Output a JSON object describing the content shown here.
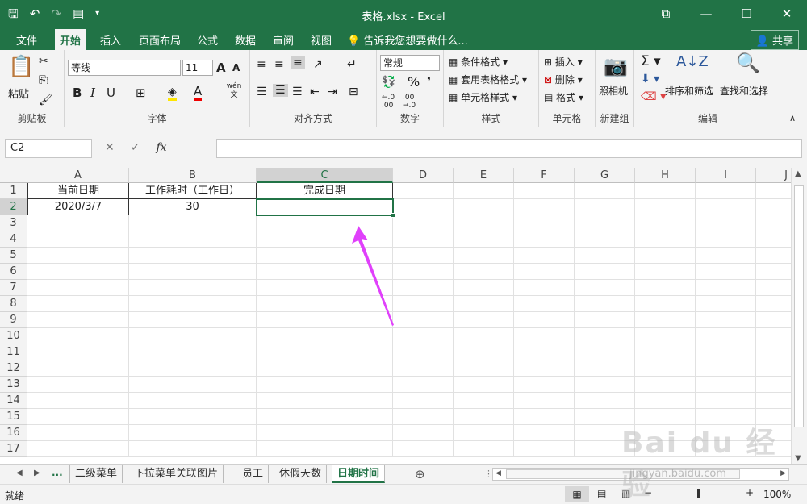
{
  "window": {
    "title": "表格.xlsx - Excel"
  },
  "menu": {
    "tabs": [
      "文件",
      "开始",
      "插入",
      "页面布局",
      "公式",
      "数据",
      "审阅",
      "视图"
    ],
    "tellme": "告诉我您想要做什么...",
    "share": "共享"
  },
  "ribbon": {
    "clipboard": {
      "paste": "粘贴",
      "label": "剪贴板"
    },
    "font": {
      "name": "等线",
      "size": "11",
      "grow": "A",
      "shrink": "A",
      "bold": "B",
      "italic": "I",
      "underline": "U",
      "color_a": "A",
      "phonetic": "wén 文",
      "label": "字体"
    },
    "align": {
      "label": "对齐方式"
    },
    "number": {
      "format": "常规",
      "percent": "%",
      "label": "数字"
    },
    "styles": {
      "conditional": "条件格式",
      "table": "套用表格格式",
      "cell": "单元格样式",
      "label": "样式"
    },
    "cells": {
      "insert": "插入",
      "delete": "删除",
      "format": "格式",
      "label": "单元格"
    },
    "newgroup": {
      "camera": "照相机",
      "label": "新建组"
    },
    "edit": {
      "sort": "排序和筛选",
      "find": "查找和选择",
      "label": "编辑"
    }
  },
  "formula": {
    "namebox": "C2",
    "fx": "fx",
    "value": ""
  },
  "columns": [
    "A",
    "B",
    "C",
    "D",
    "E",
    "F",
    "G",
    "H",
    "I",
    "J"
  ],
  "rows": [
    "1",
    "2",
    "3",
    "4",
    "5",
    "6",
    "7",
    "8",
    "9",
    "10",
    "11",
    "12",
    "13",
    "14",
    "15",
    "16",
    "17"
  ],
  "cells": {
    "A1": "当前日期",
    "B1": "工作耗时（工作日）",
    "C1": "完成日期",
    "A2": "2020/3/7",
    "B2": "30"
  },
  "sheets": {
    "more": "...",
    "tabs": [
      "二级菜单",
      "下拉菜单关联图片",
      "员工",
      "休假天数",
      "日期时间"
    ],
    "active": "日期时间"
  },
  "status": {
    "ready": "就绪",
    "zoom": "100%"
  },
  "watermark": {
    "brand": "Bai du 经验",
    "url": "jingyan.baidu.com"
  },
  "colors": {
    "excel_green": "#217346",
    "arrow": "#e040fb"
  }
}
